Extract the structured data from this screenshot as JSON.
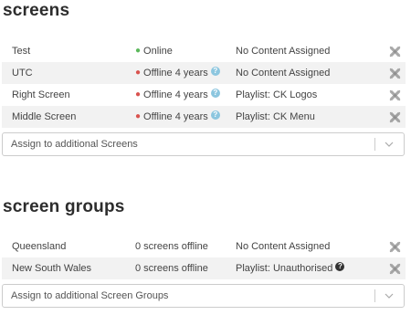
{
  "screens": {
    "title": "screens",
    "rows": [
      {
        "name": "Test",
        "status": "Online",
        "status_color": "#5cb85c",
        "content": "No Content Assigned",
        "info": false
      },
      {
        "name": "UTC",
        "status": "Offline 4 years",
        "status_color": "#d9534f",
        "content": "No Content Assigned",
        "info": true
      },
      {
        "name": "Right Screen",
        "status": "Offline 4 years",
        "status_color": "#d9534f",
        "content": "Playlist: CK Logos",
        "info": true
      },
      {
        "name": "Middle Screen",
        "status": "Offline 4 years",
        "status_color": "#d9534f",
        "content": "Playlist: CK Menu",
        "info": true
      }
    ],
    "assign_placeholder": "Assign to additional Screens"
  },
  "screen_groups": {
    "title": "screen groups",
    "rows": [
      {
        "name": "Queensland",
        "status": "0 screens offline",
        "content": "No Content Assigned",
        "help": false
      },
      {
        "name": "New South Wales",
        "status": "0 screens offline",
        "content": "Playlist: Unauthorised",
        "help": true
      }
    ],
    "assign_placeholder": "Assign to additional Screen Groups"
  },
  "icons": {
    "remove": "close-x-icon",
    "info": "info-circle-icon",
    "help": "question-circle-icon",
    "dropdown": "chevron-down-icon",
    "status": "status-dot-icon"
  }
}
